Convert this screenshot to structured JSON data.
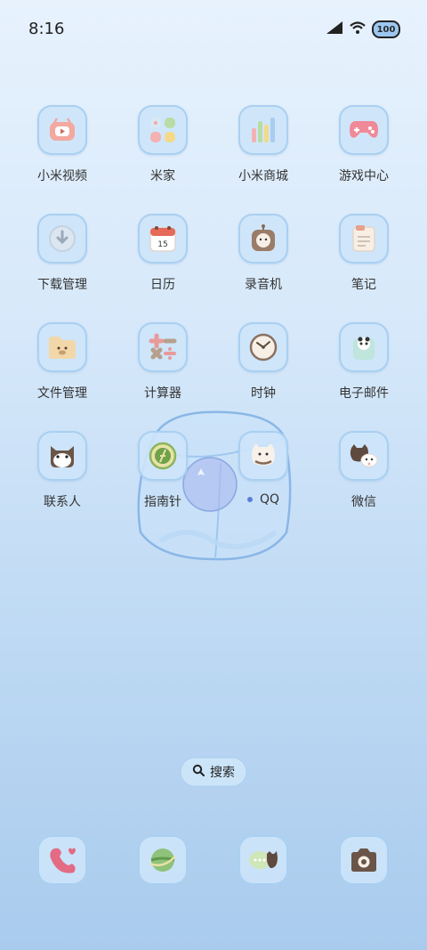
{
  "status_bar": {
    "time": "8:16",
    "icons": [
      "signal-icon",
      "wifi-icon",
      "battery-icon"
    ],
    "battery_level": "100"
  },
  "apps": [
    {
      "label": "小米视频",
      "icon": "video-icon"
    },
    {
      "label": "米家",
      "icon": "mijia-icon"
    },
    {
      "label": "小米商城",
      "icon": "mall-icon"
    },
    {
      "label": "游戏中心",
      "icon": "gamepad-icon"
    },
    {
      "label": "下载管理",
      "icon": "download-icon"
    },
    {
      "label": "日历",
      "icon": "calendar-icon",
      "badge": "15"
    },
    {
      "label": "录音机",
      "icon": "recorder-icon"
    },
    {
      "label": "笔记",
      "icon": "notes-icon"
    },
    {
      "label": "文件管理",
      "icon": "folder-icon"
    },
    {
      "label": "计算器",
      "icon": "calculator-icon"
    },
    {
      "label": "时钟",
      "icon": "clock-icon"
    },
    {
      "label": "电子邮件",
      "icon": "mail-icon"
    },
    {
      "label": "联系人",
      "icon": "contacts-icon"
    },
    {
      "label": "指南针",
      "icon": "compass-icon"
    },
    {
      "label": "QQ",
      "icon": "qq-icon"
    },
    {
      "label": "微信",
      "icon": "wechat-icon"
    }
  ],
  "search": {
    "label": "搜索",
    "icon": "search-icon"
  },
  "dock": [
    {
      "icon": "phone-icon"
    },
    {
      "icon": "browser-icon"
    },
    {
      "icon": "messages-icon"
    },
    {
      "icon": "camera-icon"
    }
  ],
  "colors": {
    "accent": "#5b7fd6",
    "tile_fill": "#cde4fa",
    "tile_border": "#a5cdf0"
  }
}
